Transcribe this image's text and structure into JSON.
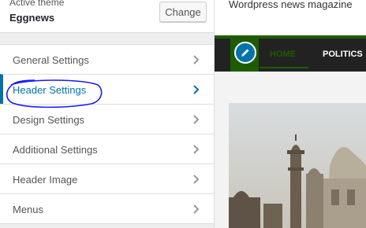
{
  "panel": {
    "active_theme_label": "Active theme",
    "theme_name": "Eggnews",
    "change_label": "Change",
    "sections": [
      {
        "label": "General Settings",
        "active": false
      },
      {
        "label": "Header Settings",
        "active": true
      },
      {
        "label": "Design Settings",
        "active": false
      },
      {
        "label": "Additional Settings",
        "active": false
      },
      {
        "label": "Header Image",
        "active": false
      },
      {
        "label": "Menus",
        "active": false
      }
    ]
  },
  "preview": {
    "tagline": "Wordpress news magazine",
    "nav": {
      "home": "HOME",
      "politics": "POLITICS"
    }
  },
  "colors": {
    "accent": "#0073aa",
    "brand_green": "#1e5c00",
    "nav_bg": "#222222",
    "annotation": "#1a1aff"
  },
  "icons": {
    "section_arrow": "chevron-right-icon",
    "edit_shortcut": "pencil-icon"
  }
}
